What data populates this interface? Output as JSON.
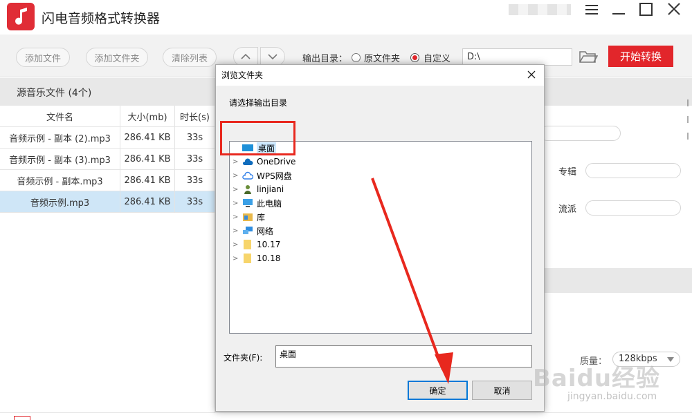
{
  "app": {
    "title": "闪电音频格式转换器"
  },
  "toolbar": {
    "add_file": "添加文件",
    "add_folder": "添加文件夹",
    "clear_list": "清除列表",
    "output_dir_label": "输出目录：",
    "opt_source_folder": "原文件夹",
    "opt_custom": "自定义",
    "output_path": "D:\\",
    "start_label": "开始转换"
  },
  "file_panel": {
    "header": "源音乐文件 (4个)",
    "columns": [
      "文件名",
      "大小(mb)",
      "时长(s)"
    ],
    "rows": [
      {
        "name": "音频示例 - 副本 (2).mp3",
        "size": "286.41 KB",
        "dur": "33s"
      },
      {
        "name": "音频示例 - 副本 (3).mp3",
        "size": "286.41 KB",
        "dur": "33s"
      },
      {
        "name": "音频示例 - 副本.mp3",
        "size": "286.41 KB",
        "dur": "33s"
      },
      {
        "name": "音频示例.mp3",
        "size": "286.41 KB",
        "dur": "33s"
      }
    ]
  },
  "right_panel": {
    "album_label": "专辑",
    "genre_label": "流派",
    "quality_label": "质量：",
    "quality_value": "128kbps"
  },
  "dialog": {
    "title": "浏览文件夹",
    "prompt": "请选择输出目录",
    "tree": [
      {
        "label": "桌面",
        "icon": "desktop-icon"
      },
      {
        "label": "OneDrive",
        "icon": "cloud-icon"
      },
      {
        "label": "WPS网盘",
        "icon": "cloud-outline-icon"
      },
      {
        "label": "linjiani",
        "icon": "user-icon"
      },
      {
        "label": "此电脑",
        "icon": "computer-icon"
      },
      {
        "label": "库",
        "icon": "library-icon"
      },
      {
        "label": "网络",
        "icon": "network-icon"
      },
      {
        "label": "10.17",
        "icon": "folder-icon"
      },
      {
        "label": "10.18",
        "icon": "folder-icon"
      }
    ],
    "folder_label": "文件夹(F):",
    "folder_value": "桌面",
    "ok_label": "确定",
    "cancel_label": "取消"
  },
  "watermark": {
    "brand": "Baidu经验",
    "url": "jingyan.baidu.com"
  },
  "colors": {
    "accent_red": "#e2262b",
    "selection_blue": "#cfe6f7",
    "annotation_red": "#e8281e"
  }
}
